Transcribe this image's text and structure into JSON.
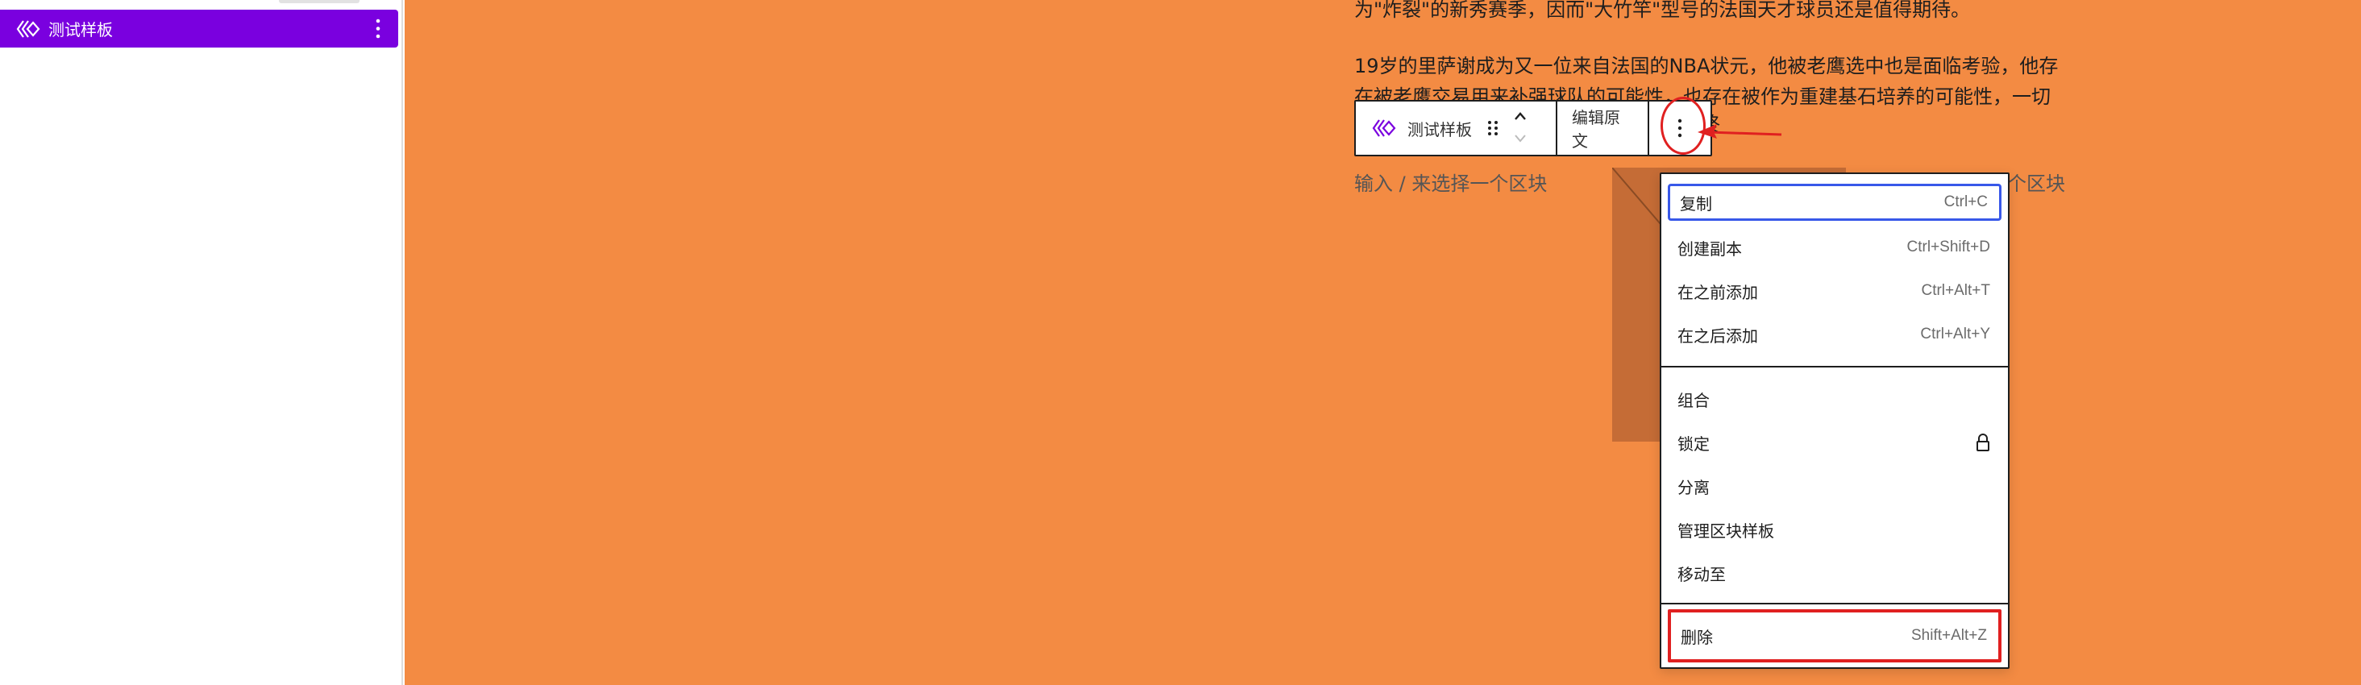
{
  "sidebar": {
    "selected_item": {
      "label": "测试样板",
      "icon": "pattern-icon",
      "more_icon": "more-vertical-icon"
    }
  },
  "canvas": {
    "background": "#f38b43",
    "paragraphs": [
      "为\"炸裂\"的新秀赛季，因而\"大竹竿\"型号的法国天才球员还是值得期待。",
      "19岁的里萨谢成为又一位来自法国的NBA状元，他被老鹰选中也是面临考验，他存",
      "在被老鹰交易用来补强球队的可能性，也存在被作为重建基石培养的可能性，一切",
      "终"
    ],
    "placeholders": [
      "输入 / 来选择一个区块",
      "个区块"
    ]
  },
  "block_toolbar": {
    "pattern_label": "测试样板",
    "edit_label": "编辑原文",
    "icons": [
      "pattern-icon",
      "drag-handle-icon",
      "chevron-up-icon",
      "chevron-down-icon",
      "more-vertical-icon"
    ]
  },
  "annotation": {
    "color": "#e02020"
  },
  "menu": {
    "groups": [
      [
        {
          "label": "复制",
          "shortcut": "Ctrl+C"
        },
        {
          "label": "创建副本",
          "shortcut": "Ctrl+Shift+D"
        },
        {
          "label": "在之前添加",
          "shortcut": "Ctrl+Alt+T"
        },
        {
          "label": "在之后添加",
          "shortcut": "Ctrl+Alt+Y"
        }
      ],
      [
        {
          "label": "组合",
          "shortcut": ""
        },
        {
          "label": "锁定",
          "shortcut": "",
          "icon": "lock-icon"
        },
        {
          "label": "分离",
          "shortcut": ""
        },
        {
          "label": "管理区块样板",
          "shortcut": ""
        },
        {
          "label": "移动至",
          "shortcut": ""
        }
      ],
      [
        {
          "label": "删除",
          "shortcut": "Shift+Alt+Z"
        }
      ]
    ]
  },
  "colors": {
    "accent": "#7a00df",
    "focus": "#3858e9"
  }
}
